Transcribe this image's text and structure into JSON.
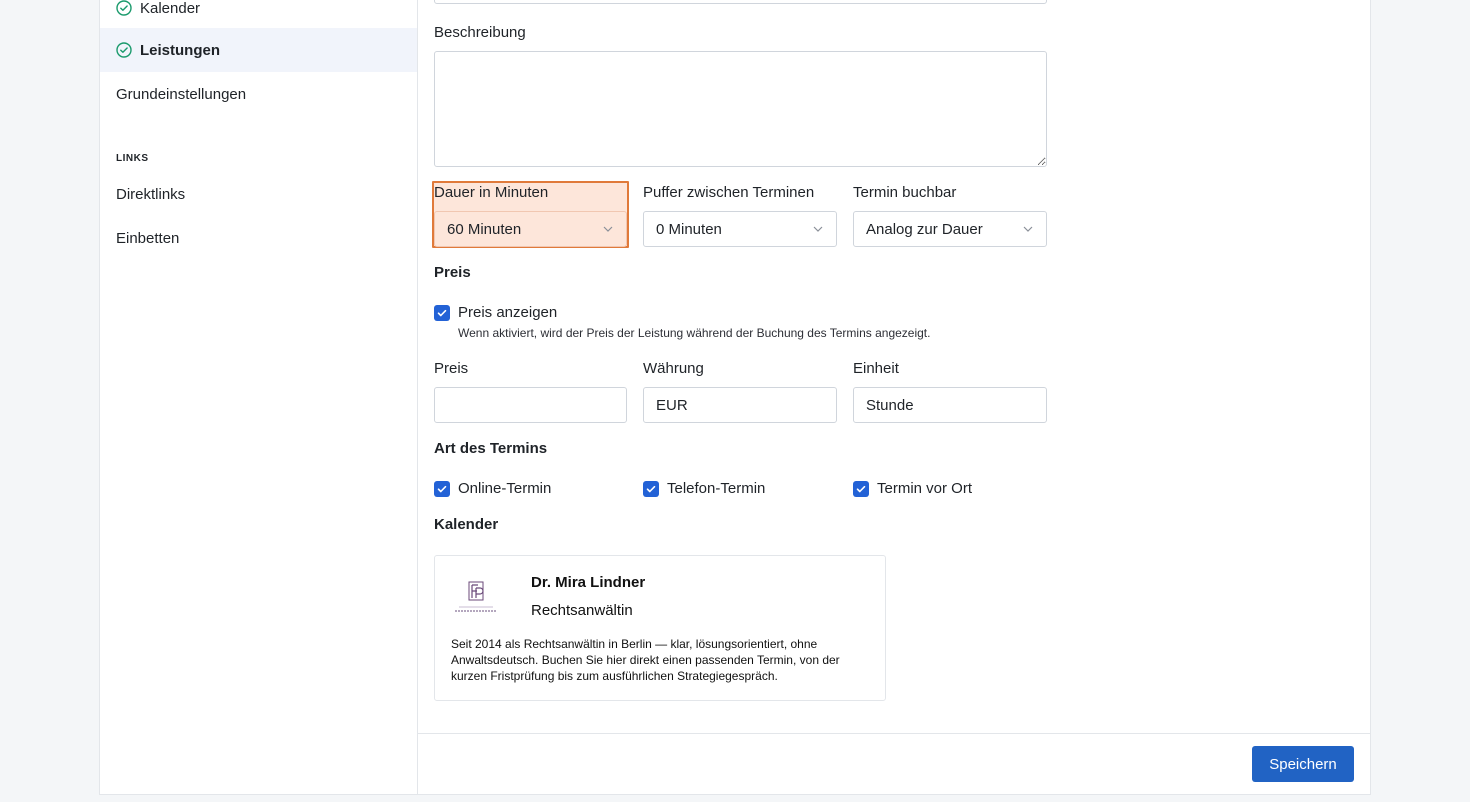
{
  "sidebar": {
    "items": [
      {
        "label": "Kalender",
        "checked": true
      },
      {
        "label": "Leistungen",
        "checked": true,
        "active": true
      },
      {
        "label": "Grundeinstellungen",
        "checked": false
      }
    ],
    "links_section_label": "LINKS",
    "links": [
      {
        "label": "Direktlinks"
      },
      {
        "label": "Einbetten"
      }
    ]
  },
  "form": {
    "beschreibung_label": "Beschreibung",
    "beschreibung_value": "",
    "dauer": {
      "label": "Dauer in Minuten",
      "value": "60 Minuten"
    },
    "puffer": {
      "label": "Puffer zwischen Terminen",
      "value": "0 Minuten"
    },
    "buchbar": {
      "label": "Termin buchbar",
      "value": "Analog zur Dauer"
    },
    "preis_heading": "Preis",
    "preis_anzeigen": {
      "label": "Preis anzeigen",
      "checked": true,
      "hint": "Wenn aktiviert, wird der Preis der Leistung während der Buchung des Termins angezeigt."
    },
    "preis": {
      "label": "Preis",
      "value": ""
    },
    "waehrung": {
      "label": "Währung",
      "value": "EUR"
    },
    "einheit": {
      "label": "Einheit",
      "value": "Stunde"
    },
    "art_heading": "Art des Termins",
    "art": [
      {
        "label": "Online-Termin",
        "checked": true
      },
      {
        "label": "Telefon-Termin",
        "checked": true
      },
      {
        "label": "Termin vor Ort",
        "checked": true
      }
    ],
    "kalender_heading": "Kalender"
  },
  "profile": {
    "name": "Dr. Mira Lindner",
    "role": "Rechtsanwältin",
    "bio": "Seit 2014 als Rechtsanwältin in Berlin — klar, lösungsorientiert, ohne Anwaltsdeutsch. Buchen Sie hier direkt einen passenden Termin, von der kurzen Fristprüfung bis zum ausführlichen Strategiegespräch."
  },
  "footer": {
    "save_label": "Speichern"
  },
  "colors": {
    "accent": "#2163c4",
    "check_green": "#1a9a6c",
    "highlight_border": "#e07a3a",
    "highlight_fill": "#fde6da"
  }
}
